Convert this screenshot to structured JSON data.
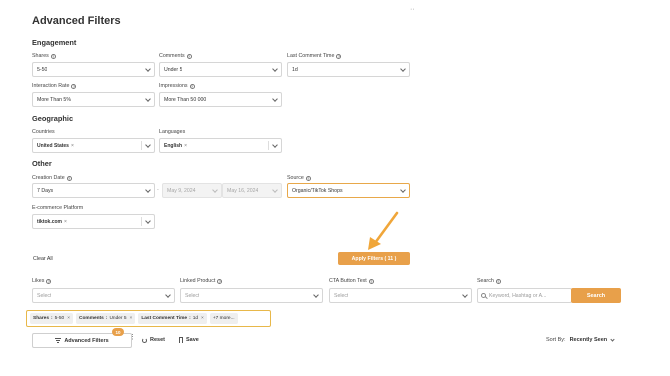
{
  "panel": {
    "title": "Advanced Filters",
    "dots": "··"
  },
  "engagement": {
    "heading": "Engagement",
    "shares": {
      "label": "Shares",
      "value": "5-50"
    },
    "comments": {
      "label": "Comments",
      "value": "Under 5"
    },
    "last_comment": {
      "label": "Last Comment Time",
      "value": "1d"
    },
    "interaction": {
      "label": "Interaction Rate",
      "value": "More Than 5%"
    },
    "impressions": {
      "label": "Impressions",
      "value": "More Than 50 000"
    }
  },
  "geographic": {
    "heading": "Geographic",
    "countries": {
      "label": "Countries",
      "chip": "United States"
    },
    "languages": {
      "label": "Languages",
      "chip": "English"
    }
  },
  "other": {
    "heading": "Other",
    "creation": {
      "label": "Creation Date",
      "value": "7 Days",
      "from": "May 9, 2024",
      "sep": "-",
      "to": "May 16, 2024"
    },
    "source": {
      "label": "Source",
      "value": "Organic/TikTok Shops"
    },
    "ecommerce": {
      "label": "E-commerce Platform",
      "chip": "tiktok.com"
    }
  },
  "actions": {
    "clear": "Clear All",
    "apply": "Apply Filters ( 11 )"
  },
  "lower": {
    "likes": {
      "label": "Likes",
      "placeholder": "Select"
    },
    "linked_product": {
      "label": "Linked Product",
      "placeholder": "Select"
    },
    "cta": {
      "label": "CTA Button Text",
      "placeholder": "Select"
    },
    "search": {
      "label": "Search",
      "placeholder": "Keyword, Hashtag or A...",
      "button": "Search"
    }
  },
  "active_filters": [
    {
      "key": "Shares",
      "value": "5-50"
    },
    {
      "key": "Comments",
      "value": "Under 5"
    },
    {
      "key": "Last Comment Time",
      "value": "1d"
    }
  ],
  "more_pill": "+7 more...",
  "toolbar": {
    "advanced_label": "Advanced Filters",
    "badge": "10",
    "reset": "Reset",
    "save": "Save",
    "sort_label": "Sort By:",
    "sort_value": "Recently Seen"
  },
  "icons": {
    "help": "help-circle-icon",
    "chevron": "chevron-down-icon",
    "remove": "close-icon",
    "search": "search-icon",
    "filter": "filter-icon",
    "reset": "reset-icon",
    "save": "bookmark-icon",
    "kebab": "more-vertical-icon",
    "arrow": "annotation-arrow"
  },
  "colors": {
    "accent": "#e8a04a",
    "highlight_border": "#e8b84a",
    "border": "#d6d6d6"
  },
  "help_glyph": "?",
  "remove_glyph": "×",
  "kebab_glyph": "⋮"
}
